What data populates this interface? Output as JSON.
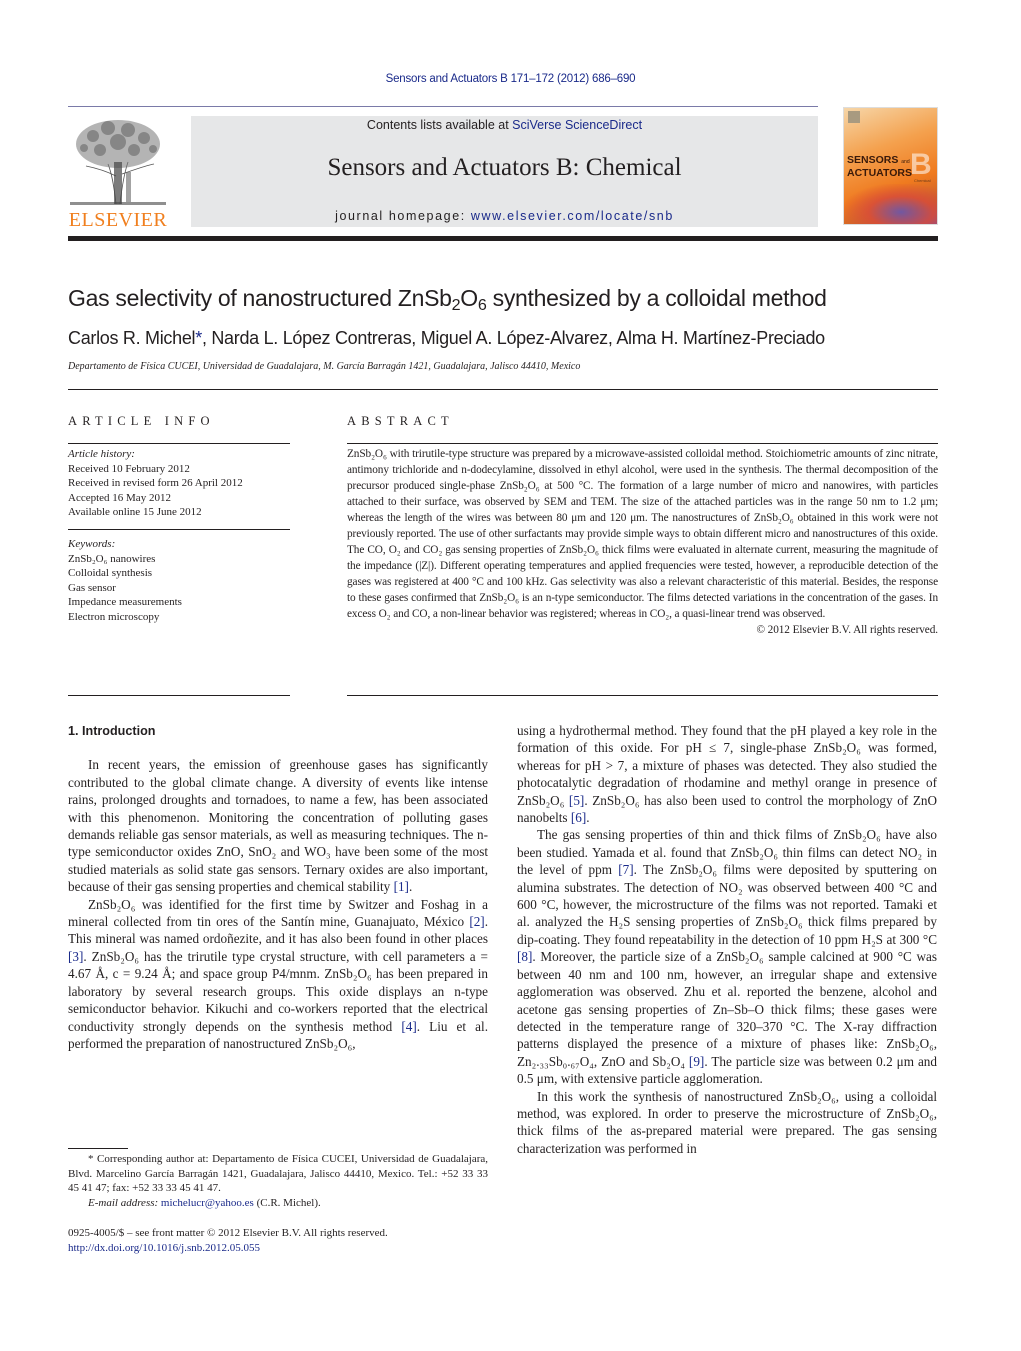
{
  "running_head": "Sensors and Actuators B 171–172 (2012) 686–690",
  "publisher": {
    "logo_word": "ELSEVIER",
    "brand_color": "#f07f1e"
  },
  "masthead": {
    "contents_prefix": "Contents lists available at ",
    "contents_link": "SciVerse ScienceDirect",
    "journal_title": "Sensors and Actuators B: Chemical",
    "homepage_prefix": "journal homepage: ",
    "homepage_url": "www.elsevier.com/locate/snb",
    "link_color": "#1a2a8a"
  },
  "cover": {
    "line1": "SENSORS",
    "and": "and",
    "line2": "ACTUATORS",
    "letter": "B",
    "subtitle": "Chemical"
  },
  "article": {
    "title_pre": "Gas selectivity of nanostructured ZnSb",
    "title_sub1": "2",
    "title_mid": "O",
    "title_sub2": "6",
    "title_post": " synthesized by a colloidal method",
    "authors": [
      "Carlos R. Michel",
      "Narda L. López Contreras",
      "Miguel A. López-Alvarez",
      "Alma H. Martínez-Preciado"
    ],
    "corresponding_marker": "*",
    "affiliation": "Departamento de Física CUCEI, Universidad de Guadalajara, M. García Barragán 1421, Guadalajara, Jalisco 44410, Mexico"
  },
  "article_info": {
    "heading": "ARTICLE INFO",
    "history_label": "Article history:",
    "history": [
      "Received 10 February 2012",
      "Received in revised form 26 April 2012",
      "Accepted 16 May 2012",
      "Available online 15 June 2012"
    ],
    "keywords_label": "Keywords:",
    "keywords": [
      "ZnSb₂O₆ nanowires",
      "Colloidal synthesis",
      "Gas sensor",
      "Impedance measurements",
      "Electron microscopy"
    ]
  },
  "abstract": {
    "heading": "ABSTRACT",
    "text": "ZnSb₂O₆ with trirutile-type structure was prepared by a microwave-assisted colloidal method. Stoichiometric amounts of zinc nitrate, antimony trichloride and n-dodecylamine, dissolved in ethyl alcohol, were used in the synthesis. The thermal decomposition of the precursor produced single-phase ZnSb₂O₆ at 500 °C. The formation of a large number of micro and nanowires, with particles attached to their surface, was observed by SEM and TEM. The size of the attached particles was in the range 50 nm to 1.2 μm; whereas the length of the wires was between 80 μm and 120 μm. The nanostructures of ZnSb₂O₆ obtained in this work were not previously reported. The use of other surfactants may provide simple ways to obtain different micro and nanostructures of this oxide. The CO, O₂ and CO₂ gas sensing properties of ZnSb₂O₆ thick films were evaluated in alternate current, measuring the magnitude of the impedance (|Z|). Different operating temperatures and applied frequencies were tested, however, a reproducible detection of the gases was registered at 400 °C and 100 kHz. Gas selectivity was also a relevant characteristic of this material. Besides, the response to these gases confirmed that ZnSb₂O₆ is an n-type semiconductor. The films detected variations in the concentration of the gases. In excess O₂ and CO, a non-linear behavior was registered; whereas in CO₂, a quasi-linear trend was observed.",
    "copyright": "© 2012 Elsevier B.V. All rights reserved."
  },
  "introduction": {
    "heading": "1.  Introduction",
    "left_paragraphs": [
      [
        {
          "t": "In recent years, the emission of greenhouse gases has significantly contributed to the global climate change. A diversity of events like intense rains, prolonged droughts and tornadoes, to name a few, has been associated with this phenomenon. Monitoring the concentration of polluting gases demands reliable gas sensor materials, as well as measuring techniques. The n-type semiconductor oxides ZnO, SnO₂ and WO₃ have been some of the most studied materials as solid state gas sensors. Ternary oxides are also important, because of their gas sensing properties and chemical stability "
        },
        {
          "r": "[1]"
        },
        {
          "t": "."
        }
      ],
      [
        {
          "t": "ZnSb₂O₆ was identified for the first time by Switzer and Foshag in a mineral collected from tin ores of the Santín mine, Guanajuato, México "
        },
        {
          "r": "[2]"
        },
        {
          "t": ". This mineral was named ordoñezite, and it has also been found in other places "
        },
        {
          "r": "[3]"
        },
        {
          "t": ". ZnSb₂O₆ has the trirutile type crystal structure, with cell parameters a = 4.67 Å, c = 9.24 Å; and space group P4/mnm. ZnSb₂O₆ has been prepared in laboratory by several research groups. This oxide displays an n-type semiconductor behavior. Kikuchi and co-workers reported that the electrical conductivity strongly depends on the synthesis method "
        },
        {
          "r": "[4]"
        },
        {
          "t": ". Liu et al. performed the preparation of nanostructured ZnSb₂O₆,"
        }
      ]
    ],
    "right_paragraphs": [
      [
        {
          "t": "using a hydrothermal method. They found that the pH played a key role in the formation of this oxide. For pH ≤ 7, single-phase ZnSb₂O₆ was formed, whereas for pH > 7, a mixture of phases was detected. They also studied the photocatalytic degradation of rhodamine and methyl orange in presence of ZnSb₂O₆ "
        },
        {
          "r": "[5]"
        },
        {
          "t": ". ZnSb₂O₆ has also been used to control the morphology of ZnO nanobelts "
        },
        {
          "r": "[6]"
        },
        {
          "t": "."
        }
      ],
      [
        {
          "t": "The gas sensing properties of thin and thick films of ZnSb₂O₆ have also been studied. Yamada et al. found that ZnSb₂O₆ thin films can detect NO₂ in the level of ppm "
        },
        {
          "r": "[7]"
        },
        {
          "t": ". The ZnSb₂O₆ films were deposited by sputtering on alumina substrates. The detection of NO₂ was observed between 400 °C and 600 °C, however, the microstructure of the films was not reported. Tamaki et al. analyzed the H₂S sensing properties of ZnSb₂O₆ thick films prepared by dip-coating. They found repeatability in the detection of 10 ppm H₂S at 300 °C "
        },
        {
          "r": "[8]"
        },
        {
          "t": ". Moreover, the particle size of a ZnSb₂O₆ sample calcined at 900 °C was between 40 nm and 100 nm, however, an irregular shape and extensive agglomeration was observed. Zhu et al. reported the benzene, alcohol and acetone gas sensing properties of Zn–Sb–O thick films; these gases were detected in the temperature range of 320–370 °C. The X-ray diffraction patterns displayed the presence of a mixture of phases like: ZnSb₂O₆, Zn₂.₃₃Sb₀.₆₇O₄, ZnO and Sb₂O₄ "
        },
        {
          "r": "[9]"
        },
        {
          "t": ". The particle size was between 0.2 μm and 0.5 μm, with extensive particle agglomeration."
        }
      ],
      [
        {
          "t": "In this work the synthesis of nanostructured ZnSb₂O₆, using a colloidal method, was explored. In order to preserve the microstructure of ZnSb₂O₆, thick films of the as-prepared material were prepared. The gas sensing characterization was performed in"
        }
      ]
    ]
  },
  "footnote": {
    "marker": "*",
    "corresponding": "Corresponding author at: Departamento de Física CUCEI, Universidad de Guadalajara, Blvd. Marcelino García Barragán 1421, Guadalajara, Jalisco 44410, Mexico. Tel.: +52 33 33 45 41 47; fax: +52 33 33 45 41 47.",
    "email_label": "E-mail address:",
    "email": "michelucr@yahoo.es",
    "email_owner": " (C.R. Michel)."
  },
  "front_matter": {
    "issn_line": "0925-4005/$ – see front matter © 2012 Elsevier B.V. All rights reserved.",
    "doi": "http://dx.doi.org/10.1016/j.snb.2012.05.055"
  }
}
